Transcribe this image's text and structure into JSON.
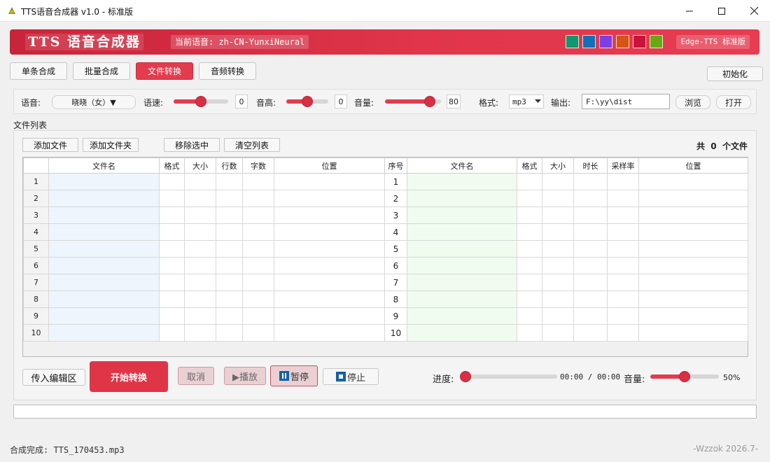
{
  "window": {
    "title": "TTS语音合成器 v1.0 - 标准版",
    "controls": [
      "minimize-icon",
      "maximize-icon",
      "close-icon"
    ]
  },
  "banner": {
    "title": "TTS 语音合成器",
    "current_voice_label": "当前语音: zh-CN-YunxiNeural",
    "edition": "Edge-TTS 标准版",
    "theme_colors": [
      "#13956e",
      "#1270b7",
      "#7b3fe4",
      "#d65414",
      "#c8143c",
      "#6aa812"
    ]
  },
  "tabs": [
    {
      "label": "单条合成",
      "active": false
    },
    {
      "label": "批量合成",
      "active": false
    },
    {
      "label": "文件转换",
      "active": true
    },
    {
      "label": "音频转换",
      "active": false
    }
  ],
  "init_button": "初始化",
  "settings": {
    "voice_label": "语音:",
    "voice_value": "晓晓（女）▼",
    "rate_label": "语速:",
    "rate_value": "0",
    "pitch_label": "音高:",
    "pitch_value": "0",
    "volume_label": "音量:",
    "volume_value": "80",
    "format_label": "格式:",
    "format_value": "mp3",
    "output_label": "输出:",
    "output_value": "F:\\yy\\dist",
    "browse_button": "浏览",
    "open_button": "打开"
  },
  "file_list": {
    "section_label": "文件列表",
    "add_file": "添加文件",
    "add_folder": "添加文件夹",
    "remove_selected": "移除选中",
    "clear_list": "清空列表",
    "count_text": "共  0  个文件"
  },
  "left_table": {
    "headers": [
      "文件名",
      "格式",
      "大小",
      "行数",
      "字数",
      "位置"
    ],
    "row_numbers": [
      "1",
      "2",
      "3",
      "4",
      "5",
      "6",
      "7",
      "8",
      "9",
      "10"
    ]
  },
  "right_table": {
    "headers": [
      "序号",
      "文件名",
      "格式",
      "大小",
      "时长",
      "采样率",
      "位置"
    ],
    "row_numbers": [
      "1",
      "2",
      "3",
      "4",
      "5",
      "6",
      "7",
      "8",
      "9",
      "10"
    ]
  },
  "actions": {
    "send_to_editor": "传入编辑区",
    "start": "开始转换",
    "cancel": "取消",
    "play": "▶播放",
    "pause": "暂停",
    "stop": "停止",
    "progress_label": "进度:",
    "time": "00:00 / 00:00",
    "volume_label": "音量:",
    "volume_value": "50%",
    "progress_fraction": 0.0,
    "volume_fraction": 0.5
  },
  "status": {
    "text": "合成完成:  TTS_170453.mp3",
    "credit": "-Wzzok 2026.7-"
  }
}
